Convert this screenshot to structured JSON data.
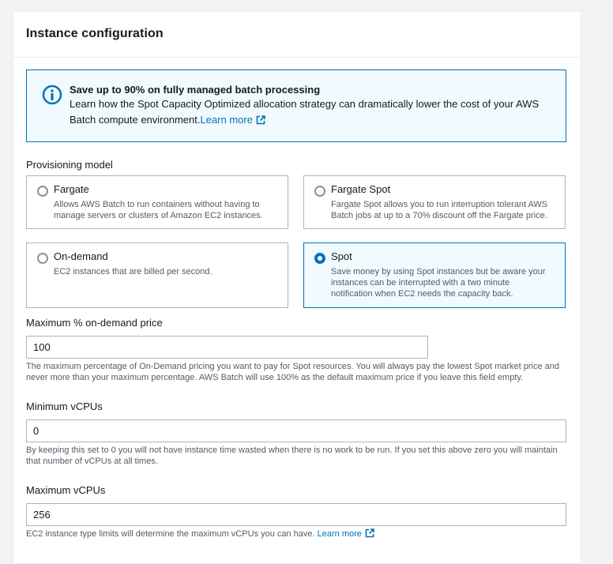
{
  "panel": {
    "title": "Instance configuration"
  },
  "info": {
    "icon": "info-icon",
    "title": "Save up to 90% on fully managed batch processing",
    "text_line1": "Learn how the Spot Capacity Optimized allocation strategy can dramatically lower the cost of your AWS",
    "text_line2": "Batch compute environment.",
    "link": "Learn more",
    "link_icon": "external-link-icon"
  },
  "provisioning": {
    "label": "Provisioning model",
    "options": [
      {
        "title": "Fargate",
        "desc_line1": "Allows AWS Batch to run containers without having to",
        "desc_line2": "manage servers or clusters of Amazon EC2 instances.",
        "desc_line3": "",
        "selected": false
      },
      {
        "title": "Fargate Spot",
        "desc_line1": "Fargate Spot allows you to run interruption tolerant AWS",
        "desc_line2": "Batch jobs at up to a 70% discount off the Fargate price.",
        "desc_line3": "",
        "selected": false
      },
      {
        "title": "On-demand",
        "desc_line1": "EC2 instances that are billed per second.",
        "desc_line2": "",
        "desc_line3": "",
        "selected": false
      },
      {
        "title": "Spot",
        "desc_line1": "Save money by using Spot instances but be aware your",
        "desc_line2": "instances can be interrupted with a two minute",
        "desc_line3": "notification when EC2 needs the capacity back.",
        "selected": true
      }
    ]
  },
  "max_ondemand": {
    "label": "Maximum % on-demand price",
    "value": "100",
    "hint_line1": "The maximum percentage of On-Demand pricing you want to pay for Spot resources. You will always pay the lowest Spot market price and",
    "hint_line2": "never more than your maximum percentage. AWS Batch will use 100% as the default maximum price if you leave this field empty."
  },
  "min_vcpus": {
    "label": "Minimum vCPUs",
    "value": "0",
    "hint_line1": "By keeping this set to 0 you will not have instance time wasted when there is no work to be run. If you set this above zero you will maintain",
    "hint_line2": "that number of vCPUs at all times."
  },
  "max_vcpus": {
    "label": "Maximum vCPUs",
    "value": "256",
    "hint": "EC2 instance type limits will determine the maximum vCPUs you can have.",
    "link": "Learn more",
    "link_icon": "external-link-icon"
  },
  "colors": {
    "accent": "#0073bb",
    "info_bg": "#f1faff",
    "border": "#aab7b8"
  }
}
